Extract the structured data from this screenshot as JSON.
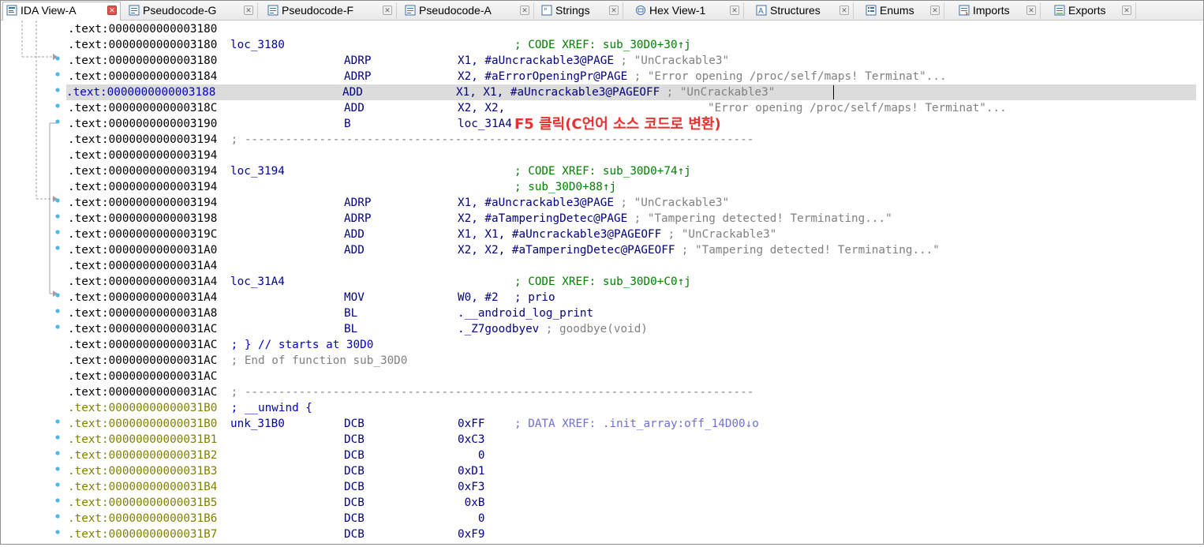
{
  "tabs": [
    {
      "label": "IDA View-A",
      "icon": "ida-view-icon",
      "active": true
    },
    {
      "label": "Pseudocode-G",
      "icon": "pseudocode-icon"
    },
    {
      "label": "Pseudocode-F",
      "icon": "pseudocode-icon"
    },
    {
      "label": "Pseudocode-A",
      "icon": "pseudocode-icon"
    },
    {
      "label": "Strings",
      "icon": "strings-icon"
    },
    {
      "label": "Hex View-1",
      "icon": "hex-view-icon"
    },
    {
      "label": "Structures",
      "icon": "structures-icon"
    },
    {
      "label": "Enums",
      "icon": "enums-icon"
    },
    {
      "label": "Imports",
      "icon": "imports-icon"
    },
    {
      "label": "Exports",
      "icon": "exports-icon"
    }
  ],
  "annotation": "F5 클릭(C언어 소스 코드로 변환)",
  "lines": [
    {
      "addr": ".text:0000000000003180"
    },
    {
      "addr": ".text:0000000000003180",
      "label": "loc_3180",
      "xref": "; CODE XREF: sub_30D0+30↑j"
    },
    {
      "addr": ".text:0000000000003180",
      "mnem": "ADRP",
      "ops": "X1, #aUncrackable3@PAGE",
      "cmt": " ; \"UnCrackable3\""
    },
    {
      "addr": ".text:0000000000003184",
      "mnem": "ADRP",
      "ops": "X2, #aErrorOpeningPr@PAGE",
      "cmt": " ; \"Error opening /proc/self/maps! Terminat\"..."
    },
    {
      "addr": ".text:0000000000003188",
      "mnem": "ADD",
      "ops": "X1, X1, #aUncrackable3@PAGEOFF",
      "cmt": " ; \"UnCrackable3\"",
      "highlight": true
    },
    {
      "addr": ".text:000000000000318C",
      "mnem": "ADD",
      "ops": "X2, X2,",
      "cmt_far": "\"Error opening /proc/self/maps! Terminat\"..."
    },
    {
      "addr": ".text:0000000000003190",
      "mnem": "B",
      "ops": "loc_31A4"
    },
    {
      "addr": ".text:0000000000003194",
      "sep": " ; ---------------------------------------------------------------------------"
    },
    {
      "addr": ".text:0000000000003194"
    },
    {
      "addr": ".text:0000000000003194",
      "label": "loc_3194",
      "xref": "; CODE XREF: sub_30D0+74↑j"
    },
    {
      "addr": ".text:0000000000003194",
      "xref": "; sub_30D0+88↑j"
    },
    {
      "addr": ".text:0000000000003194",
      "mnem": "ADRP",
      "ops": "X1, #aUncrackable3@PAGE",
      "cmt": " ; \"UnCrackable3\""
    },
    {
      "addr": ".text:0000000000003198",
      "mnem": "ADRP",
      "ops": "X2, #aTamperingDetec@PAGE",
      "cmt": " ; \"Tampering detected! Terminating...\""
    },
    {
      "addr": ".text:000000000000319C",
      "mnem": "ADD",
      "ops": "X1, X1, #aUncrackable3@PAGEOFF",
      "cmt": " ; \"UnCrackable3\""
    },
    {
      "addr": ".text:00000000000031A0",
      "mnem": "ADD",
      "ops": "X2, X2, #aTamperingDetec@PAGEOFF",
      "cmt": " ; \"Tampering detected! Terminating...\""
    },
    {
      "addr": ".text:00000000000031A4"
    },
    {
      "addr": ".text:00000000000031A4",
      "label": "loc_31A4",
      "xref": "; CODE XREF: sub_30D0+C0↑j"
    },
    {
      "addr": ".text:00000000000031A4",
      "mnem": "MOV",
      "ops": "W0, #2",
      "xref_blue": "; prio"
    },
    {
      "addr": ".text:00000000000031A8",
      "mnem": "BL",
      "ops": ".__android_log_print"
    },
    {
      "addr": ".text:00000000000031AC",
      "mnem": "BL",
      "ops": "._Z7goodbyev",
      "cmt": " ; goodbye(void)"
    },
    {
      "addr": ".text:00000000000031AC",
      "blue": " ; } // starts at 30D0"
    },
    {
      "addr": ".text:00000000000031AC",
      "grey": " ; End of function sub_30D0"
    },
    {
      "addr": ".text:00000000000031AC"
    },
    {
      "addr": ".text:00000000000031AC",
      "sep": " ; ---------------------------------------------------------------------------"
    },
    {
      "addr": ".text:00000000000031B0",
      "data": true,
      "blue": " ; __unwind {"
    },
    {
      "addr": ".text:00000000000031B0",
      "data": true,
      "label": "unk_31B0",
      "mnem": "DCB",
      "ops": "0xFF",
      "dxref": "; DATA XREF: .init_array:off_14D00↓o"
    },
    {
      "addr": ".text:00000000000031B1",
      "data": true,
      "mnem": "DCB",
      "ops": "0xC3"
    },
    {
      "addr": ".text:00000000000031B2",
      "data": true,
      "mnem": "DCB",
      "ops": "   0"
    },
    {
      "addr": ".text:00000000000031B3",
      "data": true,
      "mnem": "DCB",
      "ops": "0xD1"
    },
    {
      "addr": ".text:00000000000031B4",
      "data": true,
      "mnem": "DCB",
      "ops": "0xF3"
    },
    {
      "addr": ".text:00000000000031B5",
      "data": true,
      "mnem": "DCB",
      "ops": " 0xB"
    },
    {
      "addr": ".text:00000000000031B6",
      "data": true,
      "mnem": "DCB",
      "ops": "   0"
    },
    {
      "addr": ".text:00000000000031B7",
      "data": true,
      "mnem": "DCB",
      "ops": "0xF9"
    }
  ]
}
